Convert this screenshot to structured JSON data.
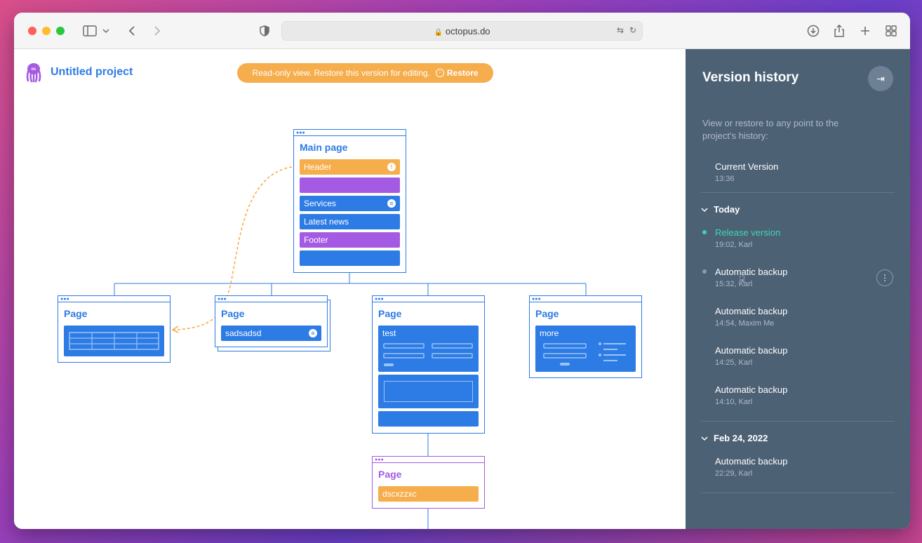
{
  "browser": {
    "url": "octopus.do",
    "traffic_colors": {
      "close": "#ff5f57",
      "minimize": "#febc2e",
      "maximize": "#28c840"
    }
  },
  "project": {
    "title": "Untitled project",
    "banner_text": "Read-only view. Restore this version for editing.",
    "restore_label": "Restore"
  },
  "sitemap": {
    "main": {
      "title": "Main page",
      "blocks": [
        {
          "label": "Header",
          "color": "#f6ad4c"
        },
        {
          "label": "",
          "color": "#a45ae2"
        },
        {
          "label": "Services",
          "color": "#2d7be5"
        },
        {
          "label": "Latest news",
          "color": "#2d7be5"
        },
        {
          "label": "Footer",
          "color": "#a45ae2"
        },
        {
          "label": "",
          "color": "#2d7be5"
        }
      ],
      "header_badge": "!"
    },
    "children": [
      {
        "title": "Page"
      },
      {
        "title": "Page",
        "block": "sadsadsd"
      },
      {
        "title": "Page",
        "block": "test"
      },
      {
        "title": "Page",
        "block": "more"
      }
    ],
    "grandchild": {
      "title": "Page",
      "block": "dscxzzxc"
    }
  },
  "sidebar": {
    "title": "Version history",
    "description": "View or restore to any point to the project’s history:",
    "current": {
      "name": "Current Version",
      "time": "13:36"
    },
    "groups": [
      {
        "label": "Today",
        "items": [
          {
            "name": "Release version",
            "meta": "19:02, Karl"
          },
          {
            "name": "Automatic backup",
            "meta": "15:32, Karl"
          },
          {
            "name": "Automatic backup",
            "meta": "14:54, Maxim Me"
          },
          {
            "name": "Automatic backup",
            "meta": "14:25, Karl"
          },
          {
            "name": "Automatic backup",
            "meta": "14:10, Karl"
          }
        ]
      },
      {
        "label": "Feb 24, 2022",
        "items": [
          {
            "name": "Automatic backup",
            "meta": "22:29, Karl"
          }
        ]
      }
    ],
    "release_color": "#3dd6b0"
  }
}
